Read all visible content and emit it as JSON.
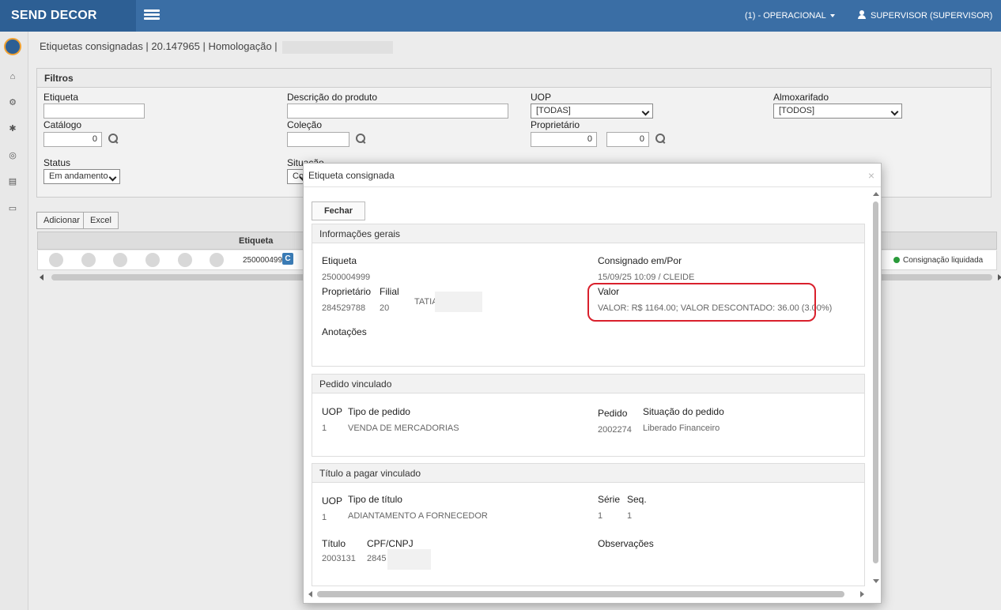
{
  "app": {
    "brand": "SEND DECOR"
  },
  "topbar": {
    "operational": "(1) - OPERACIONAL",
    "user": "SUPERVISOR (SUPERVISOR)"
  },
  "rail": {
    "icons": [
      "home-icon",
      "cogs-icon",
      "gear-icon",
      "compass-icon",
      "document-icon",
      "laptop-icon"
    ]
  },
  "page": {
    "breadcrumb": "Etiquetas consignadas | 20.147965 | Homologação |"
  },
  "filters": {
    "title": "Filtros",
    "etiqueta_label": "Etiqueta",
    "etiqueta_value": "",
    "descricao_label": "Descrição do produto",
    "descricao_value": "",
    "uop_label": "UOP",
    "uop_value": "[TODAS]",
    "almox_label": "Almoxarifado",
    "almox_value": "[TODOS]",
    "catalogo_label": "Catálogo",
    "catalogo_value": "0",
    "colecao_label": "Coleção",
    "colecao_value": "",
    "proprietario_label": "Proprietário",
    "proprietario_value1": "0",
    "proprietario_value2": "0",
    "status_label": "Status",
    "status_value": "Em andamento",
    "situacao_label": "Situação",
    "situacao_value": "Co"
  },
  "actions": {
    "adicionar": "Adicionar",
    "excel": "Excel"
  },
  "grid": {
    "column": "Etiqueta",
    "row": {
      "etiqueta": "2500004999",
      "badge": "C",
      "status": "Consignação liquidada"
    }
  },
  "modal": {
    "title": "Etiqueta consignada",
    "close_symbol": "×",
    "fechar": "Fechar",
    "geral": {
      "title": "Informações gerais",
      "etiqueta_label": "Etiqueta",
      "etiqueta_value": "2500004999",
      "consignado_label": "Consignado em/Por",
      "consignado_value": "15/09/25 10:09 / CLEIDE",
      "proprietario_label": "Proprietário",
      "proprietario_value": "284529788",
      "filial_label": "Filial",
      "filial_value": "20",
      "nome_value": "TATIA",
      "valor_label": "Valor",
      "valor_value": "VALOR: R$ 1164.00; VALOR DESCONTADO: 36.00 (3.00%)",
      "anotacoes_label": "Anotações"
    },
    "pedido": {
      "title": "Pedido vinculado",
      "uop_label": "UOP",
      "uop_value": "1",
      "tipo_label": "Tipo de pedido",
      "tipo_value": "VENDA DE MERCADORIAS",
      "pedido_label": "Pedido",
      "pedido_value": "2002274",
      "situacao_label": "Situação do pedido",
      "situacao_value": "Liberado Financeiro"
    },
    "titulo": {
      "title": "Título a pagar vinculado",
      "uop_label": "UOP",
      "uop_value": "1",
      "tipo_label": "Tipo de título",
      "tipo_value": "ADIANTAMENTO A FORNECEDOR",
      "serie_label": "Série",
      "serie_value": "1",
      "seq_label": "Seq.",
      "seq_value": "1",
      "titulo_label": "Título",
      "titulo_value": "2003131",
      "cpf_label": "CPF/CNPJ",
      "cpf_value": "2845",
      "obs_label": "Observações"
    }
  }
}
